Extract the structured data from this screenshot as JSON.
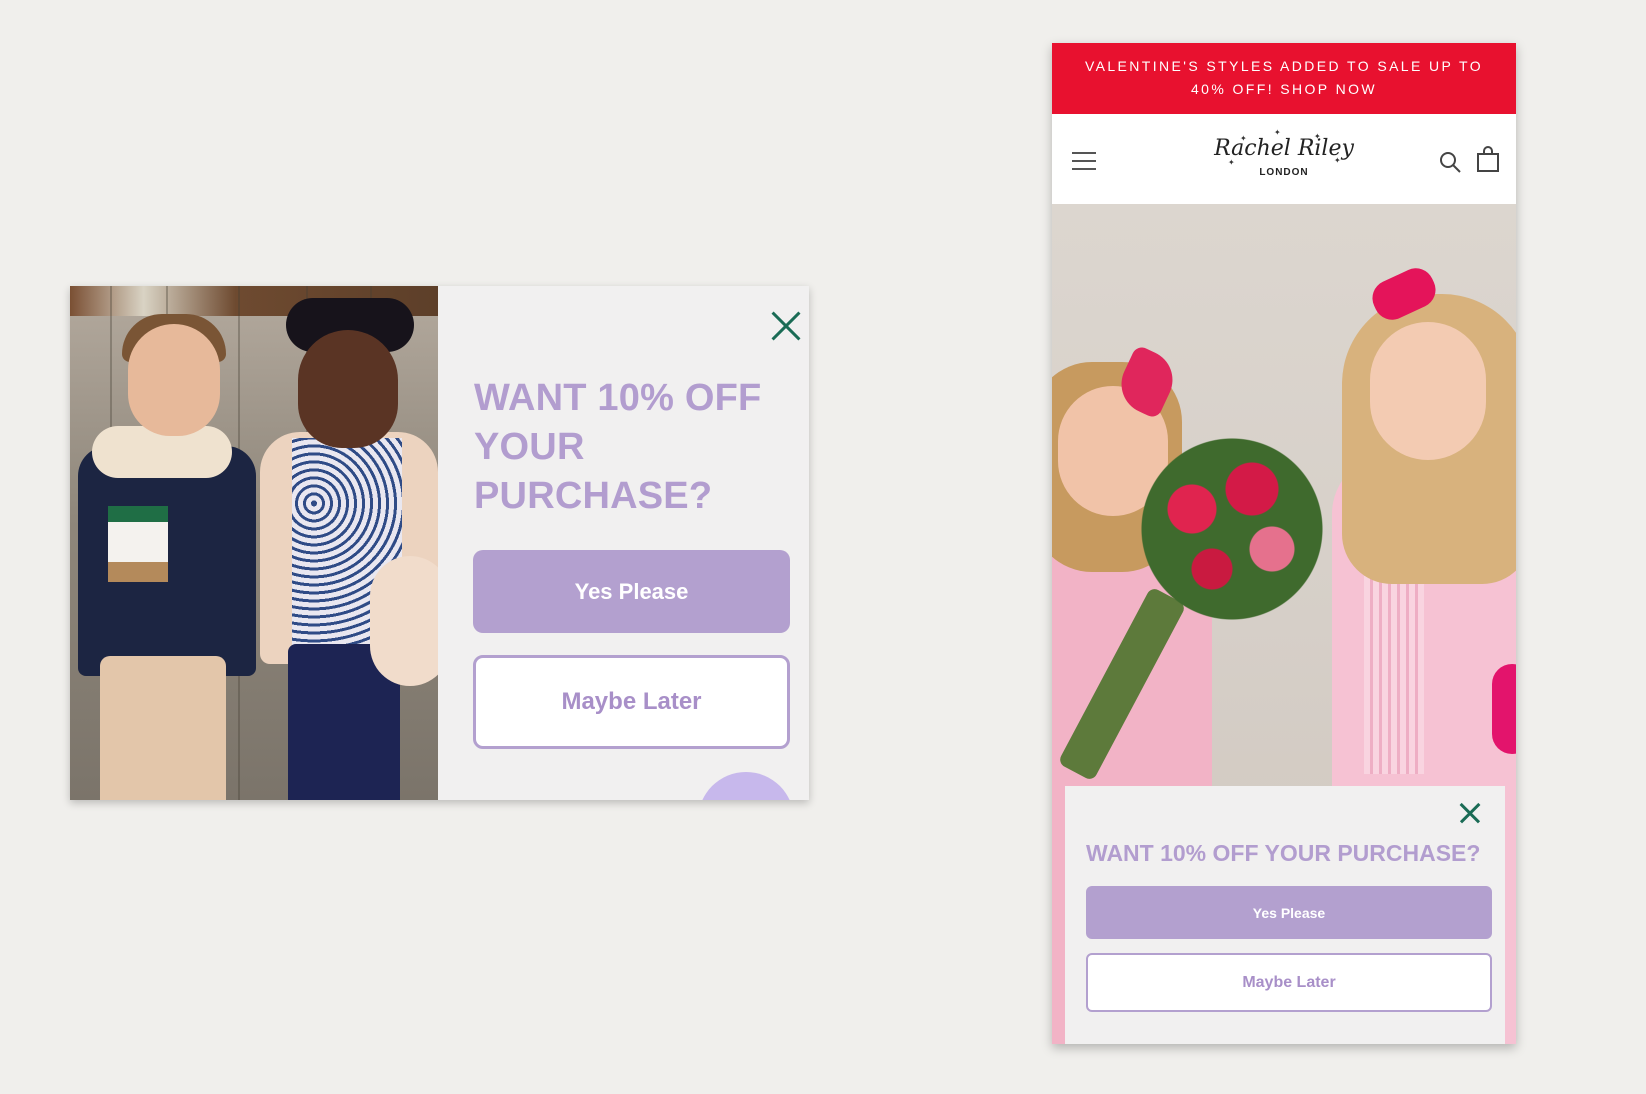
{
  "desktop_popup": {
    "headline": "WANT 10% OFF YOUR PURCHASE?",
    "yes_label": "Yes Please",
    "maybe_label": "Maybe Later",
    "close_icon": "close-icon"
  },
  "mobile": {
    "announcement": "VALENTINE'S STYLES ADDED TO SALE UP TO 40% OFF! SHOP NOW",
    "logo_script": "Rachel Riley",
    "logo_sub": "LONDON",
    "icons": {
      "menu": "hamburger-menu-icon",
      "search": "search-icon",
      "bag": "shopping-bag-icon"
    },
    "popup": {
      "headline": "WANT 10% OFF YOUR PURCHASE?",
      "yes_label": "Yes Please",
      "maybe_label": "Maybe Later",
      "close_icon": "close-icon"
    }
  },
  "colors": {
    "background": "#f0efec",
    "popup_bg": "#f1f0f0",
    "accent_purple": "#b3a0cf",
    "close_green": "#1a6b55",
    "announcement_red": "#e8112f"
  }
}
